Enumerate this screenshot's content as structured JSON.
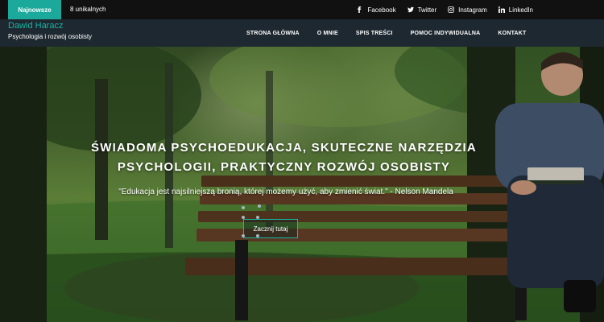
{
  "topbar": {
    "badge": "Najnowsze",
    "count": "8 unikalnych",
    "social": [
      {
        "label": "Facebook",
        "icon": "facebook-icon"
      },
      {
        "label": "Twitter",
        "icon": "twitter-icon"
      },
      {
        "label": "Instagram",
        "icon": "instagram-icon"
      },
      {
        "label": "LinkedIn",
        "icon": "linkedin-icon"
      }
    ]
  },
  "brand": {
    "title": "Dawid Haracz",
    "subtitle": "Psychologia i rozwój osobisty"
  },
  "nav": {
    "items": [
      "STRONA GŁÓWNA",
      "O MNIE",
      "SPIS TREŚCI",
      "POMOC INDYWIDUALNA",
      "KONTAKT"
    ]
  },
  "hero": {
    "headline_line1": "ŚWIADOMA PSYCHOEDUKACJA, SKUTECZNE NARZĘDZIA",
    "headline_line2": "PSYCHOLOGII, PRAKTYCZNY ROZWÓJ OSOBISTY",
    "quote": "\"Edukacja jest najsilniejszą bronią, której możemy użyć, aby zmienić świat.\" - Nelson Mandela",
    "cta_label": "Zacznij tutaj"
  },
  "colors": {
    "accent": "#19b5a5",
    "topbar_bg": "#111111",
    "navbar_bg": "#1e2830"
  }
}
